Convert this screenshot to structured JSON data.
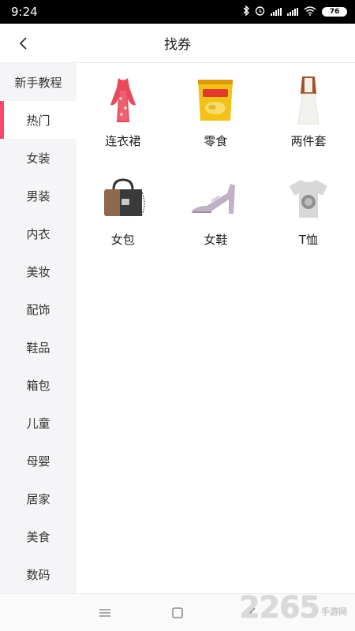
{
  "status_bar": {
    "time": "9:24",
    "battery": "76",
    "icons": [
      "bluetooth-icon",
      "alarm-icon",
      "signal-icon",
      "signal-icon",
      "wifi-icon",
      "battery-icon"
    ]
  },
  "header": {
    "title": "找券",
    "back_icon": "chevron-left-icon"
  },
  "sidebar": {
    "items": [
      {
        "label": "新手教程"
      },
      {
        "label": "热门",
        "active": true
      },
      {
        "label": "女装"
      },
      {
        "label": "男装"
      },
      {
        "label": "内衣"
      },
      {
        "label": "美妆"
      },
      {
        "label": "配饰"
      },
      {
        "label": "鞋品"
      },
      {
        "label": "箱包"
      },
      {
        "label": "儿童"
      },
      {
        "label": "母婴"
      },
      {
        "label": "居家"
      },
      {
        "label": "美食"
      },
      {
        "label": "数码"
      }
    ]
  },
  "grid": {
    "items": [
      {
        "label": "连衣裙",
        "icon": "dress-icon"
      },
      {
        "label": "零食",
        "icon": "snack-bag-icon"
      },
      {
        "label": "两件套",
        "icon": "two-piece-dress-icon"
      },
      {
        "label": "女包",
        "icon": "handbag-icon"
      },
      {
        "label": "女鞋",
        "icon": "high-heel-icon"
      },
      {
        "label": "T恤",
        "icon": "tshirt-icon"
      }
    ]
  },
  "nav_bar": {
    "buttons": [
      "menu-icon",
      "home-icon",
      "back-icon"
    ]
  },
  "watermark": {
    "number": "2265",
    "text": "手游网"
  },
  "colors": {
    "accent": "#ff4a6d",
    "sidebar_bg": "#f5f5f7"
  }
}
